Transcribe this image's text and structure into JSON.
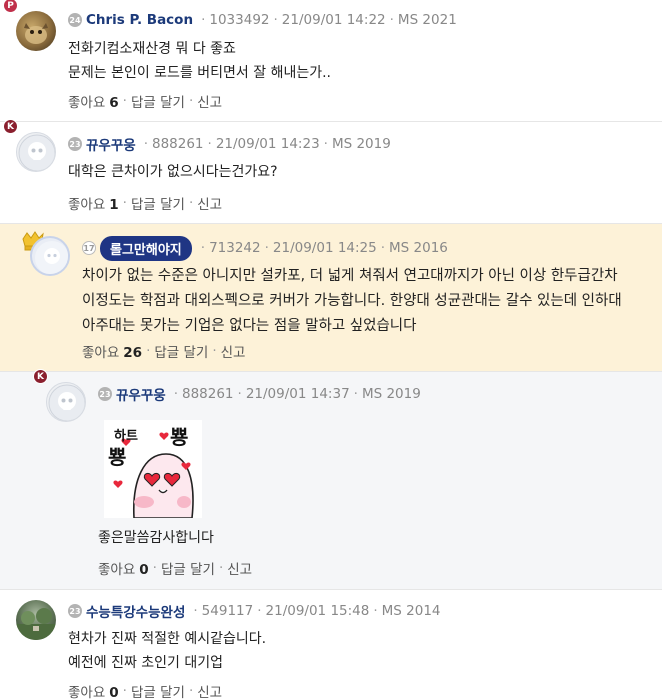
{
  "comments": [
    {
      "level": "24",
      "nickname": "Chris P. Bacon",
      "user_id": "1033492",
      "datetime": "21/09/01 14:22",
      "ms": "MS 2021",
      "badge": "P",
      "lines": [
        "전화기컴소재산경 뭐 다 좋죠",
        "문제는 본인이 로드를 버티면서 잘 해내는가.."
      ],
      "like_label": "좋아요",
      "like_count": "6",
      "reply_label": "답글 달기",
      "report_label": "신고"
    },
    {
      "level": "23",
      "nickname": "뀨우꾸웅",
      "user_id": "888261",
      "datetime": "21/09/01 14:23",
      "ms": "MS 2019",
      "badge": "K",
      "lines": [
        "대학은 큰차이가 없으시다는건가요?"
      ],
      "like_label": "좋아요",
      "like_count": "1",
      "reply_label": "답글 달기",
      "report_label": "신고"
    },
    {
      "level": "17",
      "nickname": "롤그만해야지",
      "user_id": "713242",
      "datetime": "21/09/01 14:25",
      "ms": "MS 2016",
      "lines": [
        "차이가 없는 수준은 아니지만 설카포, 더 넓게 쳐줘서 연고대까지가 아닌 이상 한두급간차",
        "이정도는 학점과 대외스펙으로 커버가 가능합니다. 한양대 성균관대는 갈수 있는데 인하대",
        "아주대는 못가는 기업은 없다는 점을 말하고 싶었습니다"
      ],
      "like_label": "좋아요",
      "like_count": "26",
      "reply_label": "답글 달기",
      "report_label": "신고"
    },
    {
      "level": "23",
      "nickname": "뀨우꾸웅",
      "user_id": "888261",
      "datetime": "21/09/01 14:37",
      "ms": "MS 2019",
      "badge": "K",
      "sticker_text": [
        "하트",
        "뿅",
        "뿅"
      ],
      "lines": [
        "좋은말씀감사합니다"
      ],
      "like_label": "좋아요",
      "like_count": "0",
      "reply_label": "답글 달기",
      "report_label": "신고"
    },
    {
      "level": "23",
      "nickname": "수능특강수능완성",
      "user_id": "549117",
      "datetime": "21/09/01 15:48",
      "ms": "MS 2014",
      "lines": [
        "현차가 진짜 적절한 예시같습니다.",
        "예전에 진짜 초인기 대기업"
      ],
      "like_label": "좋아요",
      "like_count": "0",
      "reply_label": "답글 달기",
      "report_label": "신고"
    }
  ],
  "colors": {
    "nickname": "#1c3a7a",
    "highlight_bg": "#fdf2d8",
    "reply_bg": "#f5f6f8",
    "pill_bg": "#1f3584"
  }
}
